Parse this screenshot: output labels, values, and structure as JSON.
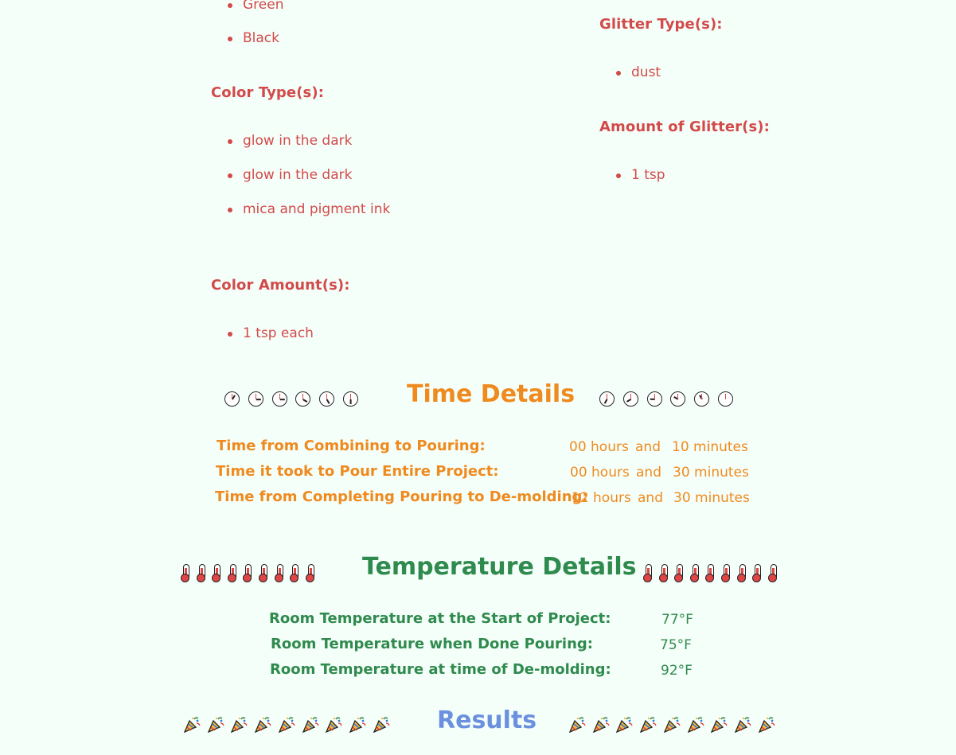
{
  "left_column": {
    "top_list": [
      "Green",
      "Black"
    ],
    "color_types_heading": "Color Type(s):",
    "color_types": [
      "glow in the dark",
      "glow in the dark",
      "mica and pigment ink"
    ],
    "color_amount_heading": "Color Amount(s):",
    "color_amounts": [
      "1 tsp each"
    ]
  },
  "right_column": {
    "glitter_types_heading": "Glitter Type(s):",
    "glitter_types": [
      "dust"
    ],
    "glitter_amount_heading": "Amount of Glitter(s):",
    "glitter_amounts": [
      "1 tsp"
    ]
  },
  "time_details": {
    "title": "Time Details",
    "icon": "clock-icon",
    "rows": [
      {
        "label": "Time from Combining to Pouring:",
        "hours": "00 hours",
        "and": "and",
        "minutes": "10 minutes"
      },
      {
        "label": "Time it took to Pour Entire Project:",
        "hours": "00 hours",
        "and": "and",
        "minutes": "30 minutes"
      },
      {
        "label": "Time from Completing Pouring to De-molding:",
        "hours": "12 hours",
        "and": "and",
        "minutes": "30 minutes"
      }
    ]
  },
  "temperature_details": {
    "title": "Temperature Details",
    "icon": "thermometer-icon",
    "rows": [
      {
        "label": "Room Temperature at the Start of Project:",
        "value": "77°F"
      },
      {
        "label": "Room Temperature when Done Pouring:",
        "value": "75°F"
      },
      {
        "label": "Room Temperature at time of De-molding:",
        "value": "92°F"
      }
    ]
  },
  "results": {
    "title": "Results",
    "icon": "party-popper-icon"
  },
  "colors": {
    "background": "#f5fffa",
    "red": "#d24a4a",
    "orange": "#ef8a1e",
    "green": "#2f8a4d",
    "blue": "#6b91de"
  }
}
